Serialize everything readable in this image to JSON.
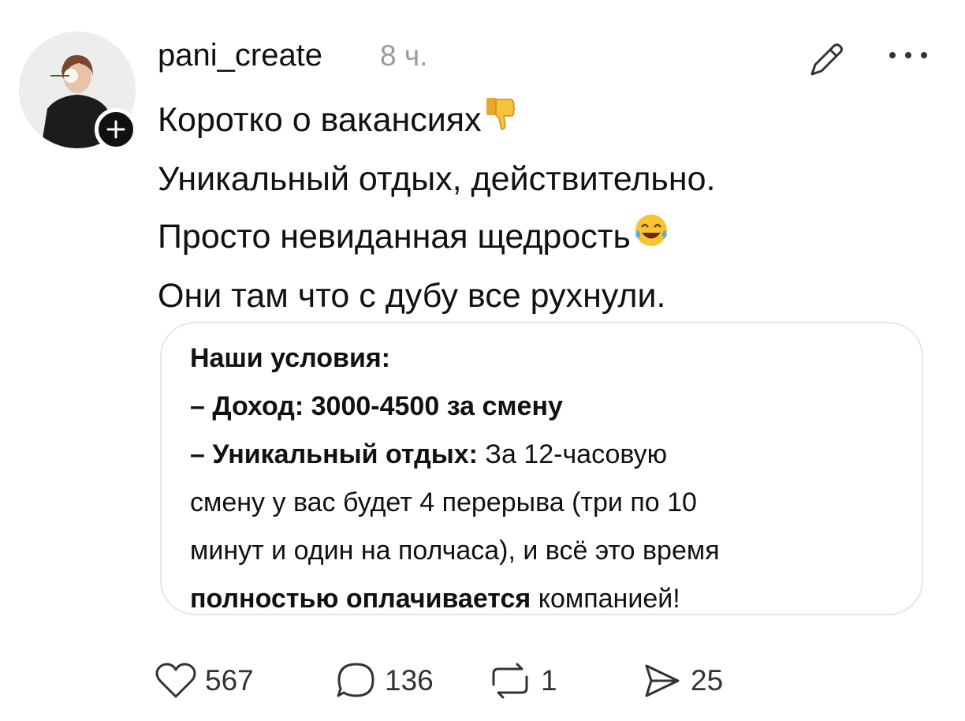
{
  "post": {
    "username": "pani_create",
    "time": "8 ч.",
    "lines": [
      "Коротко о вакансиях",
      "Уникальный отдых, действительно.",
      "Просто невиданная щедрость",
      "Они там что с дубу все рухнули."
    ],
    "emoji_line1": "thumbs-down-emoji",
    "emoji_line3": "tears-of-joy-emoji"
  },
  "card": {
    "heading": "Наши условия:",
    "income_label": "– Доход: 3000-4500 за смену",
    "rest_label": "– Уникальный отдых:",
    "rest_text_1": " За 12-часовую",
    "line_3": "смену у вас будет 4 перерыва (три по 10",
    "line_4": "минут и один на полчаса), и всё это время",
    "paid_bold": "полностью оплачивается",
    "paid_tail": " компанией!"
  },
  "actions": {
    "likes": "567",
    "comments": "136",
    "reposts": "1",
    "shares": "25"
  },
  "icons": [
    "edit-icon",
    "more-icon",
    "plus-icon",
    "heart-icon",
    "comment-icon",
    "repost-icon",
    "share-icon"
  ]
}
